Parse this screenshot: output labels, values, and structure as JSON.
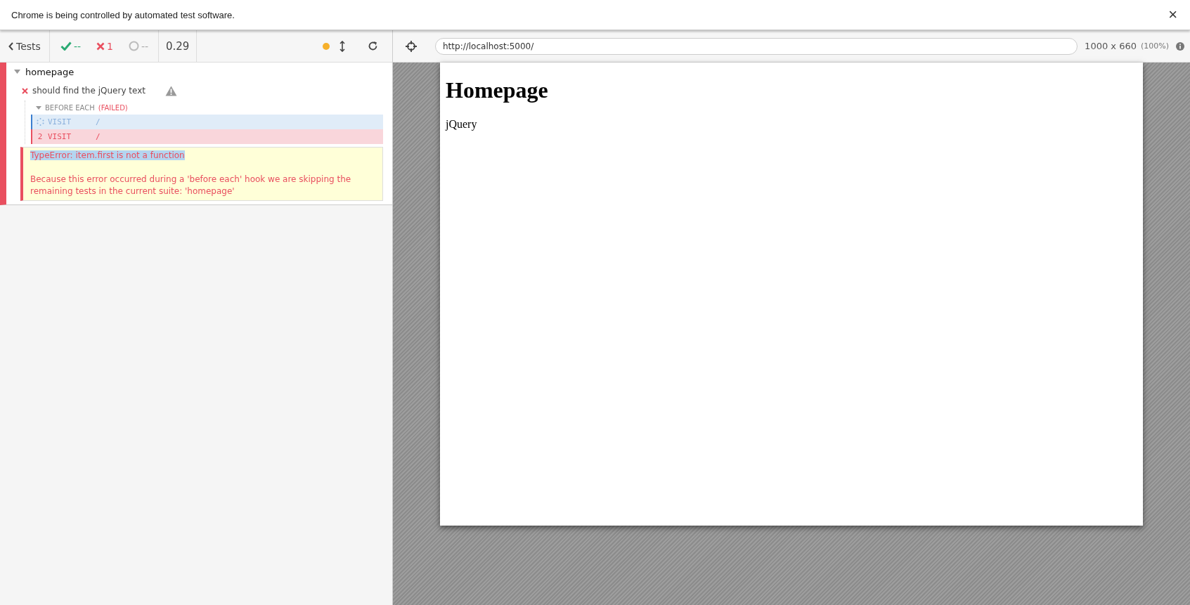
{
  "infobar": {
    "message": "Chrome is being controlled by automated test software.",
    "close": "×"
  },
  "reporter": {
    "back_label": "Tests",
    "passed": "--",
    "failed": "1",
    "pending": "--",
    "duration": "0.29",
    "running": true,
    "suite": {
      "title": "homepage",
      "expanded": true,
      "failed": true,
      "test": {
        "title": "should find the jQuery text",
        "failed": true,
        "hook": {
          "name": "BEFORE EACH",
          "status": "(FAILED)",
          "expanded": true
        },
        "commands": [
          {
            "kind": "pending",
            "name": "VISIT",
            "message": "/"
          },
          {
            "kind": "failed",
            "number": "2",
            "name": "VISIT",
            "message": "/"
          }
        ],
        "error": {
          "title": "TypeError: item.first is not a function",
          "message": "Because this error occurred during a 'before each' hook we are skipping the remaining tests in the current suite: 'homepage'"
        }
      }
    }
  },
  "aut": {
    "url": "http://localhost:5000/",
    "viewport": "1000 x 660",
    "scale": "(100%)",
    "page": {
      "heading": "Homepage",
      "text": "jQuery"
    }
  }
}
